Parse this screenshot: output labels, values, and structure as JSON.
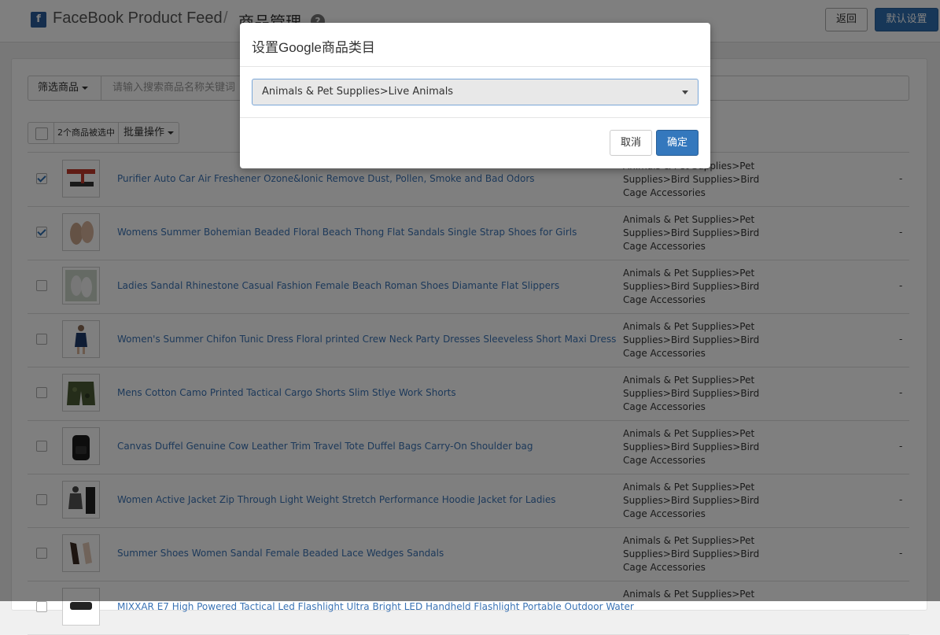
{
  "header": {
    "logo_letter": "f",
    "app_title": "FaceBook Product Feed",
    "separator": "/",
    "page_title": "商品管理",
    "help_symbol": "?",
    "back_label": "返回",
    "default_settings_label": "默认设置"
  },
  "filter": {
    "filter_label": "筛选商品",
    "search_placeholder": "请输入搜索商品名称关键词"
  },
  "bulk": {
    "selected_count_label": "2个商品被选中",
    "bulk_ops_label": "批量操作"
  },
  "products": [
    {
      "title": "Purifier Auto Car Air Freshener Ozone&Ionic Remove Dust, Pollen, Smoke and Bad Odors",
      "category": "Animals & Pet Supplies>Pet Supplies>Bird Supplies>Bird Cage Accessories",
      "extra": "-",
      "checked": true
    },
    {
      "title": "Womens Summer Bohemian Beaded Floral Beach Thong Flat Sandals Single Strap Shoes for Girls",
      "category": "Animals & Pet Supplies>Pet Supplies>Bird Supplies>Bird Cage Accessories",
      "extra": "-",
      "checked": true
    },
    {
      "title": "Ladies Sandal Rhinestone Casual Fashion Female Beach Roman Shoes Diamante Flat Slippers",
      "category": "Animals & Pet Supplies>Pet Supplies>Bird Supplies>Bird Cage Accessories",
      "extra": "-",
      "checked": false
    },
    {
      "title": "Women's Summer Chifon Tunic Dress Floral printed Crew Neck Party Dresses Sleeveless Short Maxi Dress",
      "category": "Animals & Pet Supplies>Pet Supplies>Bird Supplies>Bird Cage Accessories",
      "extra": "-",
      "checked": false
    },
    {
      "title": "Mens Cotton Camo Printed Tactical Cargo Shorts Slim Stlye Work Shorts",
      "category": "Animals & Pet Supplies>Pet Supplies>Bird Supplies>Bird Cage Accessories",
      "extra": "-",
      "checked": false
    },
    {
      "title": "Canvas Duffel Genuine Cow Leather Trim Travel Tote Duffel Bags Carry-On Shoulder bag",
      "category": "Animals & Pet Supplies>Pet Supplies>Bird Supplies>Bird Cage Accessories",
      "extra": "-",
      "checked": false
    },
    {
      "title": "Women Active Jacket Zip Through Light Weight Stretch Performance Hoodie Jacket for Ladies",
      "category": "Animals & Pet Supplies>Pet Supplies>Bird Supplies>Bird Cage Accessories",
      "extra": "-",
      "checked": false
    },
    {
      "title": "Summer Shoes Women Sandal Female Beaded Lace Wedges Sandals",
      "category": "Animals & Pet Supplies>Pet Supplies>Bird Supplies>Bird Cage Accessories",
      "extra": "-",
      "checked": false
    },
    {
      "title": "MIXXAR E7 High Powered Tactical Led Flashlight Ultra Bright LED Handheld Flashlight Portable Outdoor Water",
      "category": "Animals & Pet Supplies>Pet",
      "extra": "",
      "checked": false
    }
  ],
  "modal": {
    "title": "设置Google商品类目",
    "selected_value": "Animals & Pet Supplies>Live Animals",
    "cancel_label": "取消",
    "ok_label": "确定"
  },
  "colors": {
    "primary": "#2f6fb0",
    "link": "#3a73b5",
    "overlay": "rgba(0,0,0,0.5)"
  }
}
